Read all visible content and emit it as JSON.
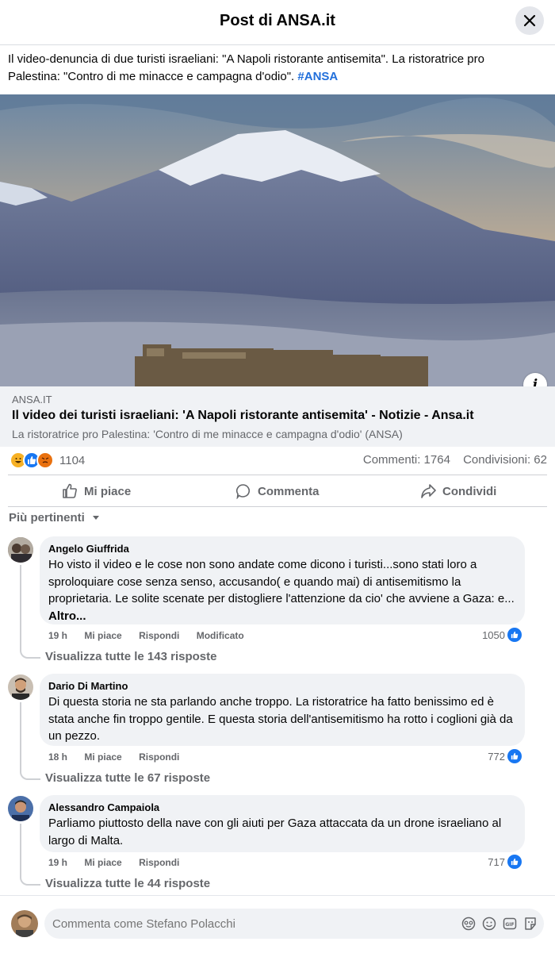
{
  "header": {
    "title": "Post di ANSA.it"
  },
  "post": {
    "text": "Il video-denuncia di due turisti israeliani: \"A Napoli ristorante antisemita\". La ristoratrice pro Palestina: \"Contro di me minacce e campagna d'odio\".",
    "hashtag": "#ANSA"
  },
  "link": {
    "domain": "ANSA.IT",
    "title": "Il video dei turisti israeliani: 'A Napoli ristorante antisemita' - Notizie - Ansa.it",
    "description": "La ristoratrice pro Palestina: 'Contro di me minacce e campagna d'odio' (ANSA)"
  },
  "engagement": {
    "reaction_count": "1104",
    "comments": "Commenti: 1764",
    "shares": "Condivisioni: 62"
  },
  "actions": {
    "like": "Mi piace",
    "comment": "Commenta",
    "share": "Condividi"
  },
  "sort_label": "Più pertinenti",
  "comments": [
    {
      "name": "Angelo Giuffrida",
      "text": "Ho visto il video e le cose non sono andate come dicono i turisti...sono stati loro a sproloquiare cose senza senso, accusando( e quando mai) di antisemitismo la proprietaria. Le solite scenate per distogliere l'attenzione da cio' che avviene a Gaza: e...",
      "more": "Altro...",
      "time": "19 h",
      "like": "Mi piace",
      "reply": "Rispondi",
      "edited": "Modificato",
      "likes": "1050",
      "replies": "Visualizza tutte le 143 risposte"
    },
    {
      "name": "Dario Di Martino",
      "text": "Di questa storia ne sta parlando anche troppo. La ristoratrice ha fatto benissimo ed è stata anche fin troppo gentile. E questa storia dell'antisemitismo ha rotto i coglioni già da un pezzo.",
      "time": "18 h",
      "like": "Mi piace",
      "reply": "Rispondi",
      "likes": "772",
      "replies": "Visualizza tutte le 67 risposte"
    },
    {
      "name": "Alessandro Campaiola",
      "text": "Parliamo piuttosto della nave con gli aiuti per Gaza attaccata da un drone israeliano al largo di Malta.",
      "time": "19 h",
      "like": "Mi piace",
      "reply": "Rispondi",
      "likes": "717",
      "replies": "Visualizza tutte le 44 risposte"
    }
  ],
  "composer": {
    "placeholder": "Commenta come Stefano Polacchi"
  },
  "colors": {
    "accent": "#1877f2",
    "hashtag": "#216fdb",
    "muted": "#65676b",
    "bubble": "#f0f2f5"
  }
}
